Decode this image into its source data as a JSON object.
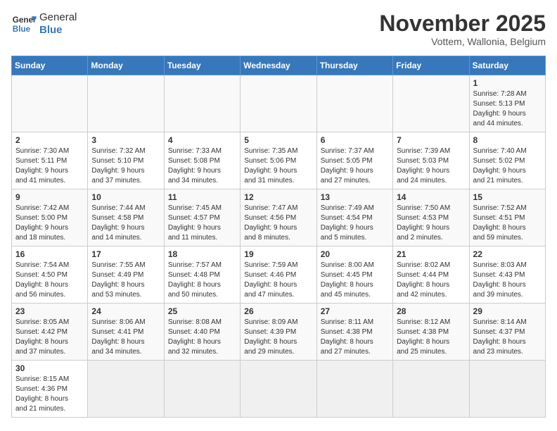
{
  "logo": {
    "text_general": "General",
    "text_blue": "Blue"
  },
  "title": "November 2025",
  "subtitle": "Vottem, Wallonia, Belgium",
  "days_of_week": [
    "Sunday",
    "Monday",
    "Tuesday",
    "Wednesday",
    "Thursday",
    "Friday",
    "Saturday"
  ],
  "weeks": [
    [
      {
        "day": "",
        "info": ""
      },
      {
        "day": "",
        "info": ""
      },
      {
        "day": "",
        "info": ""
      },
      {
        "day": "",
        "info": ""
      },
      {
        "day": "",
        "info": ""
      },
      {
        "day": "",
        "info": ""
      },
      {
        "day": "1",
        "info": "Sunrise: 7:28 AM\nSunset: 5:13 PM\nDaylight: 9 hours\nand 44 minutes."
      }
    ],
    [
      {
        "day": "2",
        "info": "Sunrise: 7:30 AM\nSunset: 5:11 PM\nDaylight: 9 hours\nand 41 minutes."
      },
      {
        "day": "3",
        "info": "Sunrise: 7:32 AM\nSunset: 5:10 PM\nDaylight: 9 hours\nand 37 minutes."
      },
      {
        "day": "4",
        "info": "Sunrise: 7:33 AM\nSunset: 5:08 PM\nDaylight: 9 hours\nand 34 minutes."
      },
      {
        "day": "5",
        "info": "Sunrise: 7:35 AM\nSunset: 5:06 PM\nDaylight: 9 hours\nand 31 minutes."
      },
      {
        "day": "6",
        "info": "Sunrise: 7:37 AM\nSunset: 5:05 PM\nDaylight: 9 hours\nand 27 minutes."
      },
      {
        "day": "7",
        "info": "Sunrise: 7:39 AM\nSunset: 5:03 PM\nDaylight: 9 hours\nand 24 minutes."
      },
      {
        "day": "8",
        "info": "Sunrise: 7:40 AM\nSunset: 5:02 PM\nDaylight: 9 hours\nand 21 minutes."
      }
    ],
    [
      {
        "day": "9",
        "info": "Sunrise: 7:42 AM\nSunset: 5:00 PM\nDaylight: 9 hours\nand 18 minutes."
      },
      {
        "day": "10",
        "info": "Sunrise: 7:44 AM\nSunset: 4:58 PM\nDaylight: 9 hours\nand 14 minutes."
      },
      {
        "day": "11",
        "info": "Sunrise: 7:45 AM\nSunset: 4:57 PM\nDaylight: 9 hours\nand 11 minutes."
      },
      {
        "day": "12",
        "info": "Sunrise: 7:47 AM\nSunset: 4:56 PM\nDaylight: 9 hours\nand 8 minutes."
      },
      {
        "day": "13",
        "info": "Sunrise: 7:49 AM\nSunset: 4:54 PM\nDaylight: 9 hours\nand 5 minutes."
      },
      {
        "day": "14",
        "info": "Sunrise: 7:50 AM\nSunset: 4:53 PM\nDaylight: 9 hours\nand 2 minutes."
      },
      {
        "day": "15",
        "info": "Sunrise: 7:52 AM\nSunset: 4:51 PM\nDaylight: 8 hours\nand 59 minutes."
      }
    ],
    [
      {
        "day": "16",
        "info": "Sunrise: 7:54 AM\nSunset: 4:50 PM\nDaylight: 8 hours\nand 56 minutes."
      },
      {
        "day": "17",
        "info": "Sunrise: 7:55 AM\nSunset: 4:49 PM\nDaylight: 8 hours\nand 53 minutes."
      },
      {
        "day": "18",
        "info": "Sunrise: 7:57 AM\nSunset: 4:48 PM\nDaylight: 8 hours\nand 50 minutes."
      },
      {
        "day": "19",
        "info": "Sunrise: 7:59 AM\nSunset: 4:46 PM\nDaylight: 8 hours\nand 47 minutes."
      },
      {
        "day": "20",
        "info": "Sunrise: 8:00 AM\nSunset: 4:45 PM\nDaylight: 8 hours\nand 45 minutes."
      },
      {
        "day": "21",
        "info": "Sunrise: 8:02 AM\nSunset: 4:44 PM\nDaylight: 8 hours\nand 42 minutes."
      },
      {
        "day": "22",
        "info": "Sunrise: 8:03 AM\nSunset: 4:43 PM\nDaylight: 8 hours\nand 39 minutes."
      }
    ],
    [
      {
        "day": "23",
        "info": "Sunrise: 8:05 AM\nSunset: 4:42 PM\nDaylight: 8 hours\nand 37 minutes."
      },
      {
        "day": "24",
        "info": "Sunrise: 8:06 AM\nSunset: 4:41 PM\nDaylight: 8 hours\nand 34 minutes."
      },
      {
        "day": "25",
        "info": "Sunrise: 8:08 AM\nSunset: 4:40 PM\nDaylight: 8 hours\nand 32 minutes."
      },
      {
        "day": "26",
        "info": "Sunrise: 8:09 AM\nSunset: 4:39 PM\nDaylight: 8 hours\nand 29 minutes."
      },
      {
        "day": "27",
        "info": "Sunrise: 8:11 AM\nSunset: 4:38 PM\nDaylight: 8 hours\nand 27 minutes."
      },
      {
        "day": "28",
        "info": "Sunrise: 8:12 AM\nSunset: 4:38 PM\nDaylight: 8 hours\nand 25 minutes."
      },
      {
        "day": "29",
        "info": "Sunrise: 8:14 AM\nSunset: 4:37 PM\nDaylight: 8 hours\nand 23 minutes."
      }
    ],
    [
      {
        "day": "30",
        "info": "Sunrise: 8:15 AM\nSunset: 4:36 PM\nDaylight: 8 hours\nand 21 minutes."
      },
      {
        "day": "",
        "info": ""
      },
      {
        "day": "",
        "info": ""
      },
      {
        "day": "",
        "info": ""
      },
      {
        "day": "",
        "info": ""
      },
      {
        "day": "",
        "info": ""
      },
      {
        "day": "",
        "info": ""
      }
    ]
  ]
}
